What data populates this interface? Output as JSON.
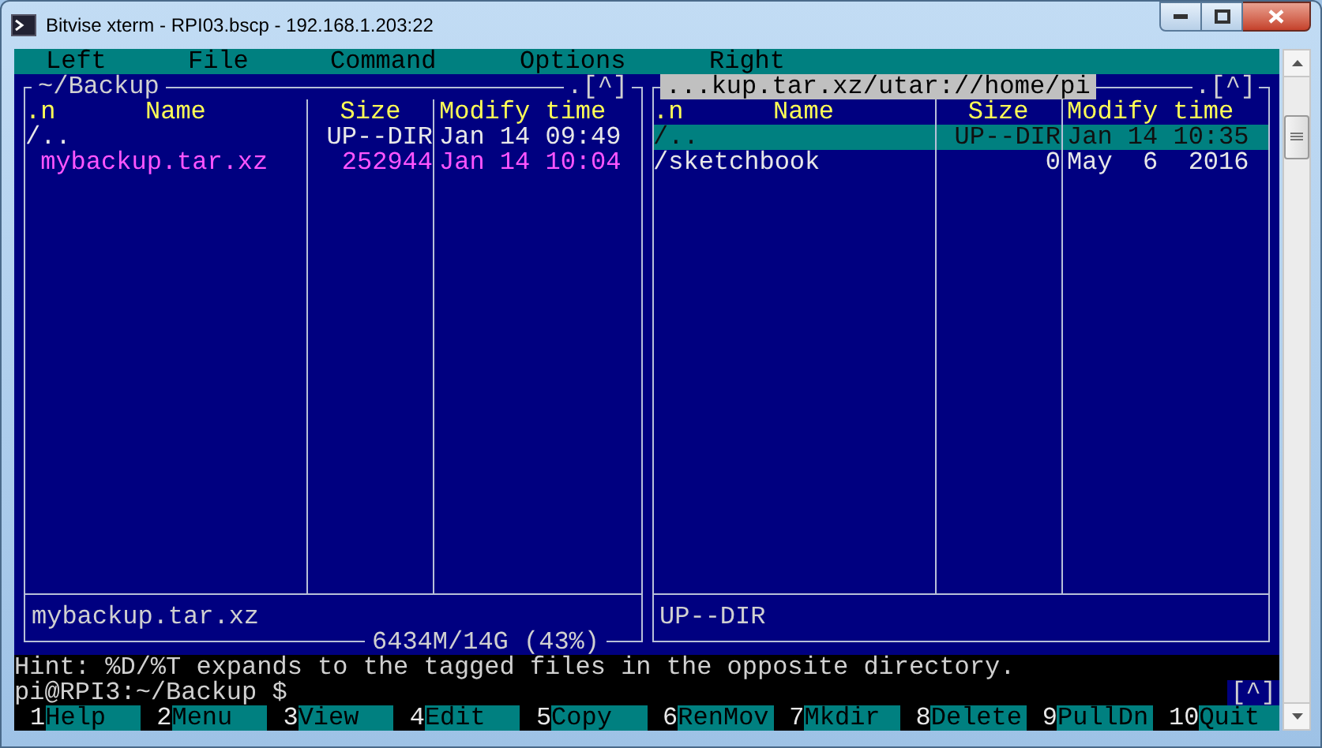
{
  "window": {
    "title": "Bitvise xterm - RPI03.bscp - 192.168.1.203:22"
  },
  "menu": [
    "Left",
    "File",
    "Command",
    "Options",
    "Right"
  ],
  "panels": [
    {
      "path": "~/Backup",
      "active": false,
      "sort_marker": ".[^]",
      "columns": [
        ".n",
        "Name",
        "Size",
        "Modify time"
      ],
      "rows": [
        {
          "name": "/..",
          "size": "UP--DIR",
          "time": "Jan 14 09:49",
          "kind": "dir",
          "selected": false
        },
        {
          "name": " mybackup.tar.xz",
          "size": "252944",
          "time": "Jan 14 10:04",
          "kind": "archive",
          "selected": false
        }
      ],
      "info": "mybackup.tar.xz",
      "usage": "6434M/14G (43%)"
    },
    {
      "path": "...kup.tar.xz/utar://home/pi",
      "active": true,
      "sort_marker": ".[^]",
      "columns": [
        ".n",
        "Name",
        "Size",
        "Modify time"
      ],
      "rows": [
        {
          "name": "/..",
          "size": "UP--DIR",
          "time": "Jan 14 10:35",
          "kind": "dir",
          "selected": true
        },
        {
          "name": "/sketchbook",
          "size": "0",
          "time": "May  6  2016",
          "kind": "dir",
          "selected": false
        }
      ],
      "info": "UP--DIR"
    }
  ],
  "hint": "Hint: %D/%T expands to the tagged files in the opposite directory.",
  "prompt": "pi@RPI3:~/Backup $",
  "prompt_indicator": "[^]",
  "function_keys": [
    {
      "number": "1",
      "label": "Help"
    },
    {
      "number": "2",
      "label": "Menu"
    },
    {
      "number": "3",
      "label": "View"
    },
    {
      "number": "4",
      "label": "Edit"
    },
    {
      "number": "5",
      "label": "Copy"
    },
    {
      "number": "6",
      "label": "RenMov"
    },
    {
      "number": "7",
      "label": "Mkdir"
    },
    {
      "number": "8",
      "label": "Delete"
    },
    {
      "number": "9",
      "label": "PullDn"
    },
    {
      "number": "10",
      "label": "Quit"
    }
  ]
}
